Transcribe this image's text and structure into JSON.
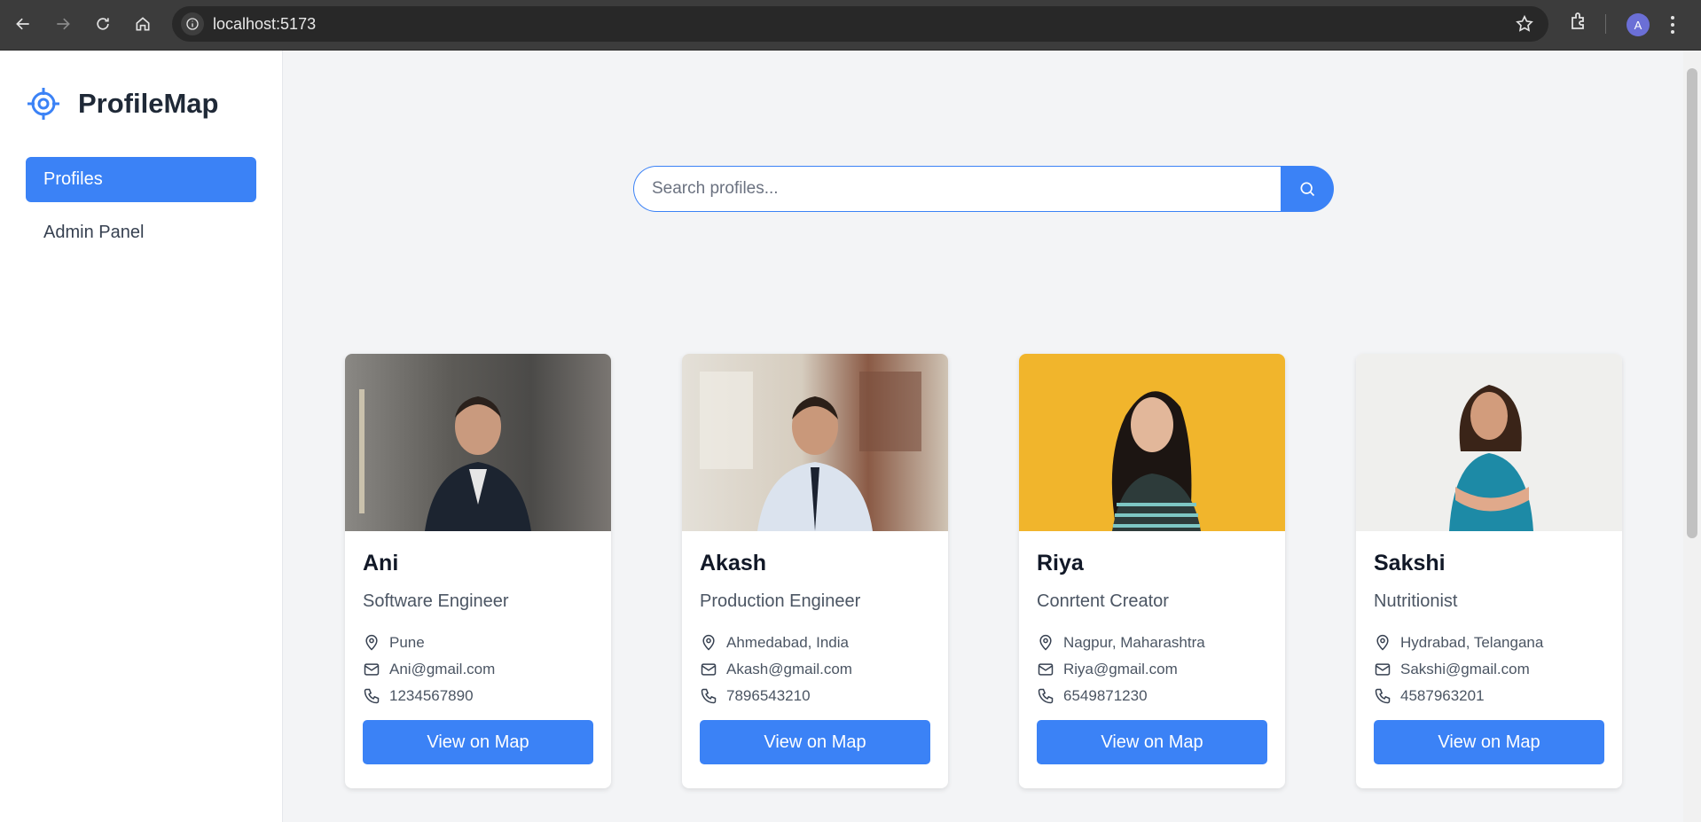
{
  "browser": {
    "url": "localhost:5173",
    "profile_initial": "A"
  },
  "sidebar": {
    "brand": "ProfileMap",
    "items": [
      {
        "label": "Profiles",
        "active": true
      },
      {
        "label": "Admin Panel",
        "active": false
      }
    ]
  },
  "search": {
    "placeholder": "Search profiles..."
  },
  "profiles": [
    {
      "name": "Ani",
      "role": "Software Engineer",
      "location": "Pune",
      "email": "Ani@gmail.com",
      "phone": "1234567890",
      "button": "View on Map",
      "photo_bg": "#6b6a66"
    },
    {
      "name": "Akash",
      "role": "Production Engineer",
      "location": "Ahmedabad, India",
      "email": "Akash@gmail.com",
      "phone": "7896543210",
      "button": "View on Map",
      "photo_bg": "#b8ada2"
    },
    {
      "name": "Riya",
      "role": "Conrtent Creator",
      "location": "Nagpur, Maharashtra",
      "email": "Riya@gmail.com",
      "phone": "6549871230",
      "button": "View on Map",
      "photo_bg": "#f1b52c"
    },
    {
      "name": "Sakshi",
      "role": "Nutritionist",
      "location": "Hydrabad, Telangana",
      "email": "Sakshi@gmail.com",
      "phone": "4587963201",
      "button": "View on Map",
      "photo_bg": "#eeeeec"
    }
  ],
  "colors": {
    "accent": "#3b82f6",
    "sidebar_bg": "#ffffff",
    "page_bg": "#f3f4f6"
  }
}
